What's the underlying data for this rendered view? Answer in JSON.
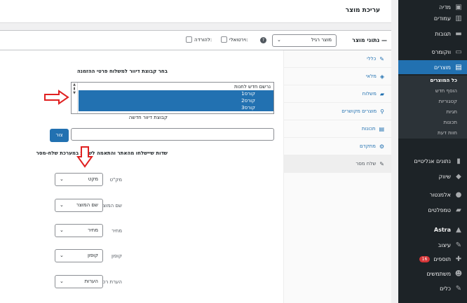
{
  "page": {
    "title": "עריכת מוצר"
  },
  "sidebar": {
    "items": [
      {
        "label": "מדיה",
        "icon": "media-icon"
      },
      {
        "label": "עמודים",
        "icon": "pages-icon"
      },
      {
        "label": "תגובות",
        "icon": "comments-icon"
      },
      {
        "label": "ווקומרס",
        "icon": "woo-icon"
      },
      {
        "label": "מוצרים",
        "icon": "products-icon"
      },
      {
        "label": "נתונים אנליטיים",
        "icon": "analytics-icon"
      },
      {
        "label": "שיווק",
        "icon": "marketing-icon"
      },
      {
        "label": "אלמנטור",
        "icon": "elementor-icon"
      },
      {
        "label": "טמפלטים",
        "icon": "templates-icon"
      },
      {
        "label": "Astra",
        "icon": "astra-icon"
      },
      {
        "label": "עיצוב",
        "icon": "appearance-icon"
      },
      {
        "label": "תוספים",
        "icon": "plugins-icon",
        "badge": "16"
      },
      {
        "label": "משתמשים",
        "icon": "users-icon"
      },
      {
        "label": "כלים",
        "icon": "tools-icon"
      }
    ],
    "submenu": [
      "כל המוצרים",
      "הוסף חדש",
      "קטגוריות",
      "תגיות",
      "תכונות",
      "חוות דעת"
    ]
  },
  "product_data": {
    "title": "נתוני מוצר —",
    "type_select": "מוצר רגיל",
    "virtual_label": "וירטואלי:",
    "download_label": "להורדה:",
    "help": "?"
  },
  "tabs": [
    "כללי",
    "מלאי",
    "משלוח",
    "מוצרים מקושרים",
    "תכונות",
    "מתקדם",
    "שלח מסר"
  ],
  "shipping": {
    "group_label": "בחר קבוצת דיוור למשלוח פרטי ההזמנה",
    "options": [
      "נרשם חדש לחנות",
      "קורס1",
      "קורס2",
      "קורס3"
    ],
    "new_group_label": "קבוצת דיוור חדשה",
    "create_button": "צור",
    "mapping_label": "שדות שיישלחו מהאתר והתאמה לשדות במערכת שלח-מסר"
  },
  "field_map": [
    {
      "label": "מק\"ט",
      "value": "מקט"
    },
    {
      "label": "שם המוצר",
      "value": "שם המוצר"
    },
    {
      "label": "מחיר",
      "value": "מחיר"
    },
    {
      "label": "קופון",
      "value": "קופון"
    },
    {
      "label": "הערת רכישה",
      "value": "הערות"
    }
  ],
  "colors": {
    "accent": "#2271b1",
    "sidebar": "#1d2327",
    "annotation": "#e02020"
  }
}
